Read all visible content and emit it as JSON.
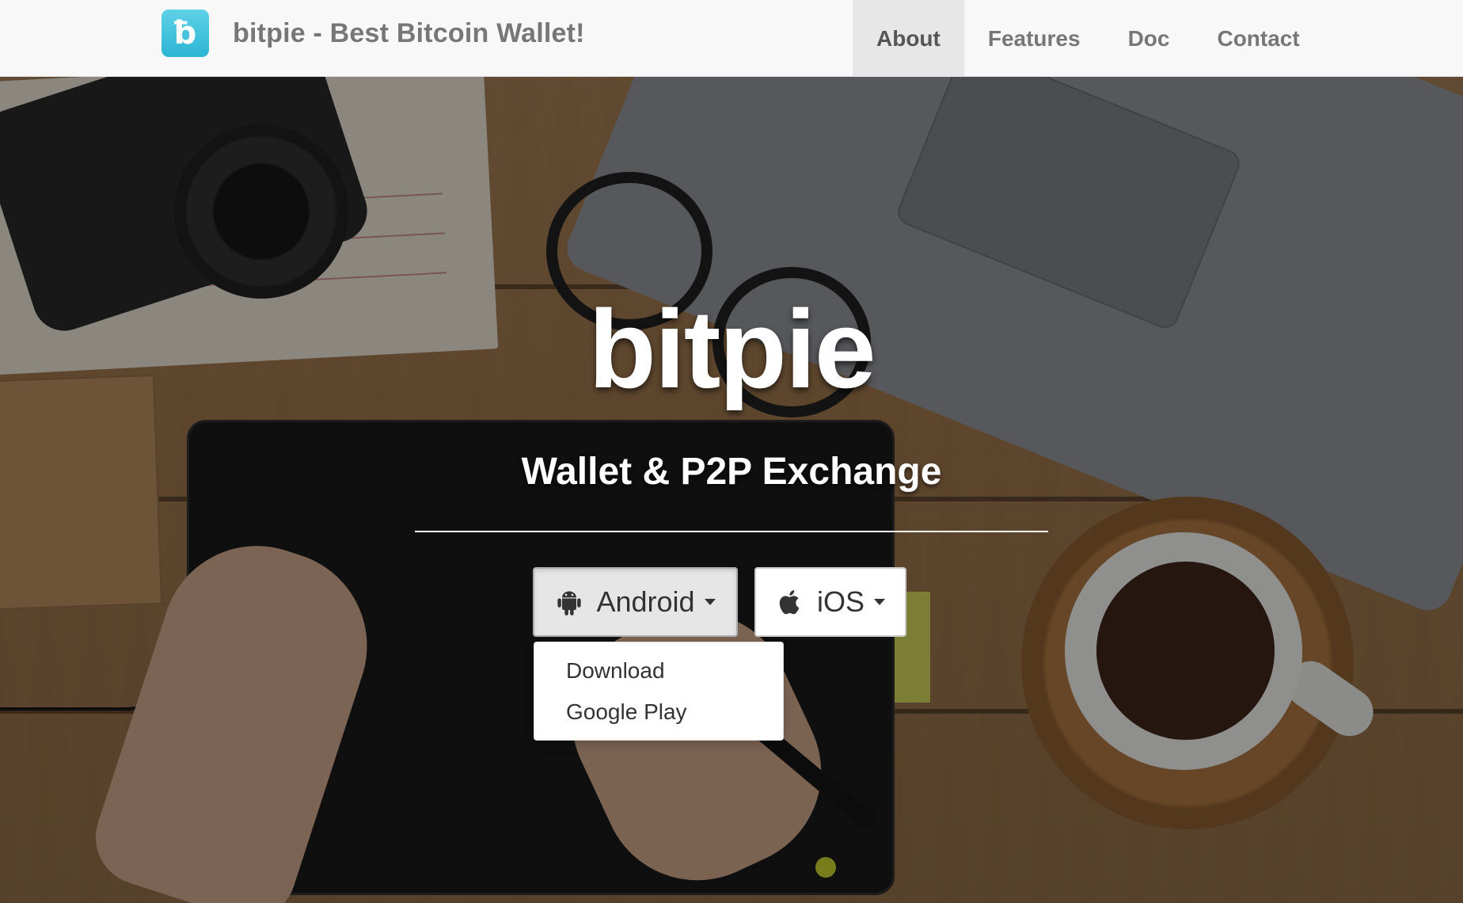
{
  "navbar": {
    "brand": {
      "logo_glyph": "ƀ",
      "logo_icon": "bitpie-logo-icon",
      "title": "bitpie - Best Bitcoin Wallet!"
    },
    "items": [
      {
        "label": "About",
        "active": true
      },
      {
        "label": "Features",
        "active": false
      },
      {
        "label": "Doc",
        "active": false
      },
      {
        "label": "Contact",
        "active": false
      }
    ]
  },
  "hero": {
    "title": "bitpie",
    "subtitle": "Wallet & P2P Exchange",
    "buttons": {
      "android": {
        "label": "Android",
        "icon": "android-icon",
        "open": true
      },
      "ios": {
        "label": "iOS",
        "icon": "apple-icon",
        "open": false
      }
    },
    "android_dropdown": {
      "items": [
        {
          "label": "Download"
        },
        {
          "label": "Google Play"
        }
      ]
    }
  },
  "colors": {
    "logo_accent": "#2cb6d4",
    "navbar_bg": "#f8f8f8",
    "nav_active_bg": "#e7e7e7"
  }
}
